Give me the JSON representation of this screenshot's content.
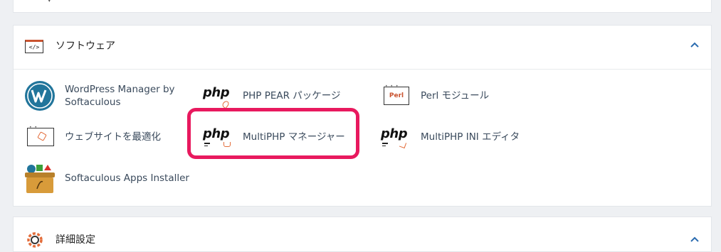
{
  "software_section": {
    "title": "ソフトウェア",
    "head_icon_text": "</>",
    "items": [
      {
        "label": "WordPress Manager by Softaculous",
        "icon": "wordpress-icon"
      },
      {
        "label": "PHP PEAR パッケージ",
        "icon": "php-pear-icon"
      },
      {
        "label": "Perl モジュール",
        "icon": "perl-icon"
      },
      {
        "label": "ウェブサイトを最適化",
        "icon": "optimize-website-icon"
      },
      {
        "label": "MultiPHP マネージャー",
        "icon": "multiphp-manager-icon"
      },
      {
        "label": "MultiPHP INI エディタ",
        "icon": "multiphp-ini-icon"
      },
      {
        "label": "Softaculous Apps Installer",
        "icon": "softaculous-icon"
      }
    ],
    "php_logo": "php",
    "perl_logo": "Perl"
  },
  "advanced_section": {
    "title": "詳細設定"
  },
  "colors": {
    "accent": "#e36d3b",
    "highlight": "#e8195e",
    "link": "#3a4a5c"
  }
}
